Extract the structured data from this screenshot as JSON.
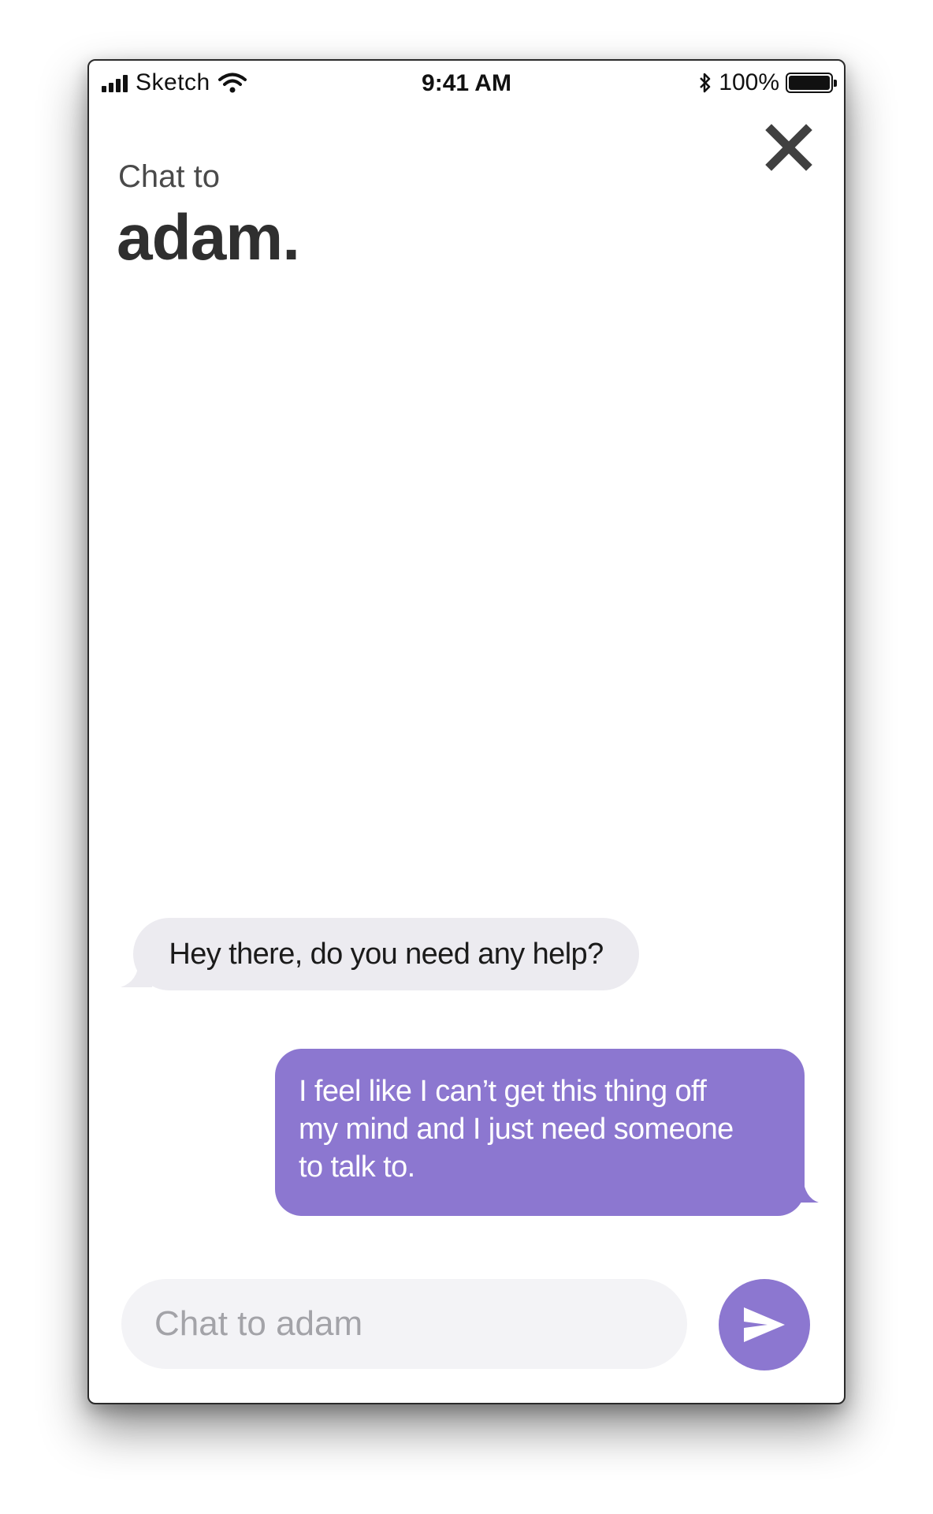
{
  "status_bar": {
    "carrier": "Sketch",
    "time": "9:41 AM",
    "battery_percent": "100%",
    "battery_level": 1.0,
    "icons": [
      "signal-icon",
      "wifi-icon",
      "bluetooth-icon",
      "battery-icon"
    ]
  },
  "header": {
    "subtitle": "Chat to",
    "title": "adam.",
    "close_icon": "close-icon"
  },
  "messages": [
    {
      "from": "agent",
      "text": "Hey there, do you need any help?"
    },
    {
      "from": "user",
      "lines": [
        "I feel like I can’t get this thing off",
        "my mind and I just need someone",
        "to talk to."
      ]
    }
  ],
  "composer": {
    "placeholder": "Chat to adam",
    "value": "",
    "send_icon": "send-icon"
  },
  "colors": {
    "accent": "#8c77d0",
    "incoming_bubble": "#ecebf0",
    "input_background": "#f3f3f6",
    "title_text": "#2f2f2f",
    "placeholder_text": "#a3a3a8"
  }
}
